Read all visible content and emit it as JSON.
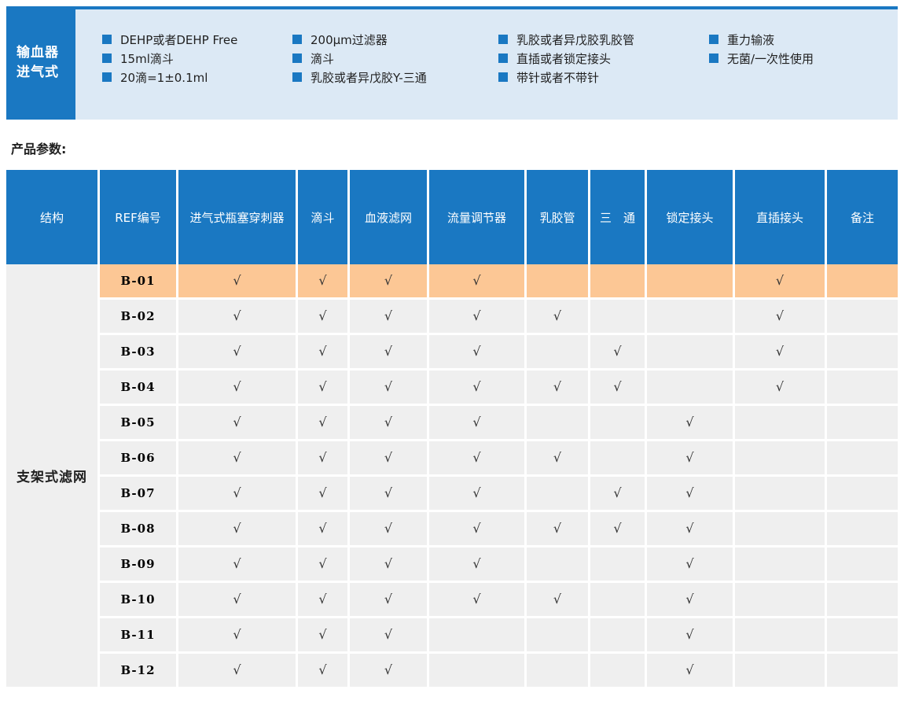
{
  "colors": {
    "primary_blue": "#1A78C2",
    "panel_light_blue": "#DCE9F5",
    "row_gray": "#EFEFEF",
    "highlight_orange": "#FCC795",
    "header_text": "#FFFFFF",
    "body_text": "#1F1F1F"
  },
  "hero": {
    "title_line1": "输血器",
    "title_line2": "进气式",
    "feature_columns": [
      [
        "DEHP或者DEHP Free",
        "15ml滴斗",
        "20滴=1±0.1ml"
      ],
      [
        "200μm过滤器",
        "滴斗",
        "乳胶或者异戊胶Y-三通"
      ],
      [
        "乳胶或者异戊胶乳胶管",
        "直插或者锁定接头",
        "带针或者不带针"
      ],
      [
        "重力输液",
        "无菌/一次性使用"
      ]
    ]
  },
  "section_title": "产品参数:",
  "table": {
    "structure_label": "支架式滤网",
    "check_glyph": "√",
    "columns": [
      "结构",
      "REF编号",
      "进气式瓶塞穿刺器",
      "滴斗",
      "血液滤网",
      "流量调节器",
      "乳胶管",
      "三　通",
      "锁定接头",
      "直插接头",
      "备注"
    ],
    "feature_column_keys": [
      "进气式瓶塞穿刺器",
      "滴斗",
      "血液滤网",
      "流量调节器",
      "乳胶管",
      "三　通",
      "锁定接头",
      "直插接头"
    ],
    "rows": [
      {
        "ref": "B-01",
        "highlight": true,
        "checks": [
          1,
          1,
          1,
          1,
          0,
          0,
          0,
          1
        ],
        "remark": ""
      },
      {
        "ref": "B-02",
        "highlight": false,
        "checks": [
          1,
          1,
          1,
          1,
          1,
          0,
          0,
          1
        ],
        "remark": ""
      },
      {
        "ref": "B-03",
        "highlight": false,
        "checks": [
          1,
          1,
          1,
          1,
          0,
          1,
          0,
          1
        ],
        "remark": ""
      },
      {
        "ref": "B-04",
        "highlight": false,
        "checks": [
          1,
          1,
          1,
          1,
          1,
          1,
          0,
          1
        ],
        "remark": ""
      },
      {
        "ref": "B-05",
        "highlight": false,
        "checks": [
          1,
          1,
          1,
          1,
          0,
          0,
          1,
          0
        ],
        "remark": ""
      },
      {
        "ref": "B-06",
        "highlight": false,
        "checks": [
          1,
          1,
          1,
          1,
          1,
          0,
          1,
          0
        ],
        "remark": ""
      },
      {
        "ref": "B-07",
        "highlight": false,
        "checks": [
          1,
          1,
          1,
          1,
          0,
          1,
          1,
          0
        ],
        "remark": ""
      },
      {
        "ref": "B-08",
        "highlight": false,
        "checks": [
          1,
          1,
          1,
          1,
          1,
          1,
          1,
          0
        ],
        "remark": ""
      },
      {
        "ref": "B-09",
        "highlight": false,
        "checks": [
          1,
          1,
          1,
          1,
          0,
          0,
          1,
          0
        ],
        "remark": ""
      },
      {
        "ref": "B-10",
        "highlight": false,
        "checks": [
          1,
          1,
          1,
          1,
          1,
          0,
          1,
          0
        ],
        "remark": ""
      },
      {
        "ref": "B-11",
        "highlight": false,
        "checks": [
          1,
          1,
          1,
          0,
          0,
          0,
          1,
          0
        ],
        "remark": ""
      },
      {
        "ref": "B-12",
        "highlight": false,
        "checks": [
          1,
          1,
          1,
          0,
          0,
          0,
          1,
          0
        ],
        "remark": ""
      }
    ]
  }
}
